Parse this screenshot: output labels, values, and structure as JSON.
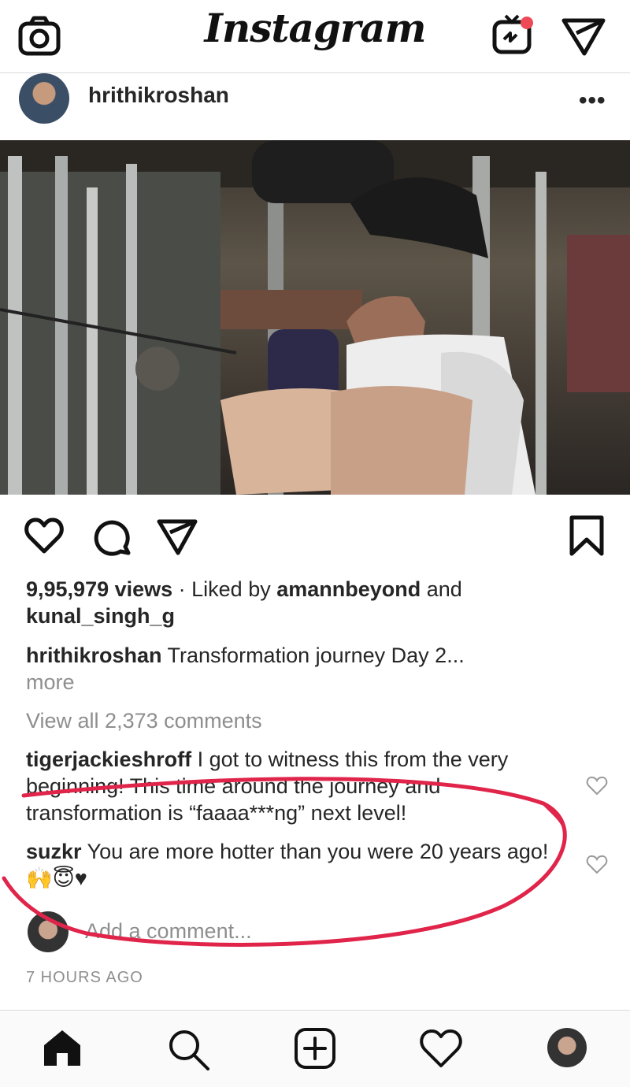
{
  "app": {
    "logo_text": "Instagram"
  },
  "post": {
    "username": "hrithikroshan",
    "more_label": "•••",
    "views": "9,95,979 views",
    "liked_by_sep": " · Liked by ",
    "liked_by_1": "amannbeyond",
    "liked_and": " and",
    "liked_by_2": "kunal_singh_g",
    "caption_user": "hrithikroshan",
    "caption_text": " Transformation journey Day 2...",
    "caption_more": "more",
    "view_all": "View all 2,373 comments",
    "timestamp": "7 HOURS AGO"
  },
  "comments": [
    {
      "user": "tigerjackieshroff",
      "text": " I got to witness this from the very beginning! This time around the journey and transformation is “faaaa***ng” next level!"
    },
    {
      "user": "suzkr",
      "text": " You are more hotter than you were 20 years ago! 🙌😇♥"
    }
  ],
  "add_comment": {
    "placeholder": "Add a comment..."
  },
  "colors": {
    "text": "#262626",
    "muted": "#8e8e8e",
    "divider": "#dbdbdb",
    "notification": "#ed4956",
    "annotation": "#e0244a"
  },
  "icons": {
    "camera": "camera-icon",
    "igtv": "igtv-icon",
    "direct": "direct-message-icon",
    "like": "heart-icon",
    "comment": "comment-icon",
    "share": "share-icon",
    "save": "bookmark-icon",
    "home": "home-icon",
    "search": "search-icon",
    "new_post": "new-post-icon",
    "activity": "activity-heart-icon",
    "profile": "profile-avatar"
  }
}
